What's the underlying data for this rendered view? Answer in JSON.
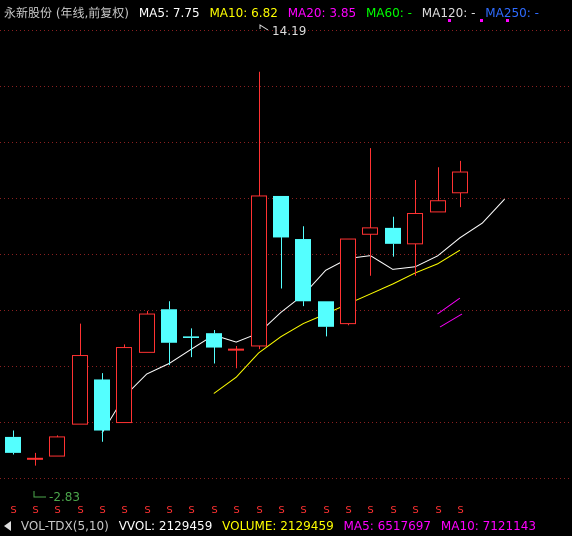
{
  "header": {
    "title": "永新股份 (年线,前复权)",
    "ma5_label": "MA5: 7.75",
    "ma10_label": "MA10: 6.82",
    "ma20_label": "MA20: 3.85",
    "ma60_label": "MA60: -",
    "ma120_label": "MA120: -",
    "ma250_label": "MA250: -"
  },
  "colors": {
    "up": "#ff3232",
    "down": "#54ffff",
    "ma5": "#ffffff",
    "ma10": "#ffff00",
    "ma20": "#ff00ff",
    "ma60": "#00ff00",
    "ma120": "#dddddd",
    "ma250": "#2e6bff",
    "grid": "#8a2020",
    "dividend_marker": "#ff3232"
  },
  "volume_bar": {
    "indicator_label": "VOL-TDX(5,10)",
    "vvol_label": "VVOL: 2129459",
    "volume_label": "VOLUME: 2129459",
    "ma5_label": "MA5: 6517697",
    "ma10_label": "MA10: 7121143"
  },
  "chart_data": {
    "type": "candlestick",
    "ylim": [
      1.4,
      15.5
    ],
    "high_annotation": "14.19",
    "low_annotation": "-2.83",
    "candles": [
      {
        "open": 2.75,
        "close": 2.25,
        "high": 2.95,
        "low": 2.2
      },
      {
        "open": 2.05,
        "close": 2.08,
        "high": 2.25,
        "low": 1.85
      },
      {
        "open": 2.15,
        "close": 2.75,
        "high": 2.8,
        "low": 2.15
      },
      {
        "open": 3.15,
        "close": 5.3,
        "high": 6.3,
        "low": 3.15
      },
      {
        "open": 4.55,
        "close": 2.95,
        "high": 4.75,
        "low": 2.6
      },
      {
        "open": 3.2,
        "close": 5.55,
        "high": 5.65,
        "low": 3.2
      },
      {
        "open": 5.4,
        "close": 6.6,
        "high": 6.7,
        "low": 5.4
      },
      {
        "open": 6.75,
        "close": 5.7,
        "high": 7.0,
        "low": 5.0
      },
      {
        "open": 5.9,
        "close": 5.85,
        "high": 6.15,
        "low": 5.25
      },
      {
        "open": 6.0,
        "close": 5.55,
        "high": 6.1,
        "low": 5.05
      },
      {
        "open": 5.5,
        "close": 5.5,
        "high": 5.6,
        "low": 4.9
      },
      {
        "open": 5.6,
        "close": 10.3,
        "high": 14.19,
        "low": 5.5
      },
      {
        "open": 10.3,
        "close": 9.0,
        "high": 10.3,
        "low": 7.4
      },
      {
        "open": 8.95,
        "close": 7.0,
        "high": 9.35,
        "low": 6.85
      },
      {
        "open": 7.0,
        "close": 6.2,
        "high": 7.0,
        "low": 5.9
      },
      {
        "open": 6.3,
        "close": 8.95,
        "high": 8.95,
        "low": 6.25
      },
      {
        "open": 9.1,
        "close": 9.3,
        "high": 11.8,
        "low": 7.8
      },
      {
        "open": 9.3,
        "close": 8.8,
        "high": 9.65,
        "low": 8.4
      },
      {
        "open": 8.8,
        "close": 9.75,
        "high": 10.8,
        "low": 7.8
      },
      {
        "open": 9.8,
        "close": 10.15,
        "high": 11.2,
        "low": 9.8
      },
      {
        "open": 10.4,
        "close": 11.05,
        "high": 11.4,
        "low": 9.95
      }
    ],
    "series": [
      {
        "name": "MA5",
        "start": 4,
        "values": [
          2.87,
          4.02,
          4.72,
          5.05,
          5.5,
          5.94,
          5.72,
          6.0,
          6.65,
          7.2,
          7.97,
          8.34,
          8.43,
          8.0,
          8.08,
          8.42,
          8.99,
          9.45,
          10.2
        ]
      },
      {
        "name": "MA10",
        "start": 9,
        "values": [
          4.11,
          4.62,
          5.38,
          5.89,
          6.3,
          6.6,
          6.92,
          7.23,
          7.54,
          7.89,
          8.17,
          8.6
        ]
      },
      {
        "name": "MA20",
        "start": 19,
        "values": [
          6.6,
          7.1
        ]
      }
    ]
  }
}
